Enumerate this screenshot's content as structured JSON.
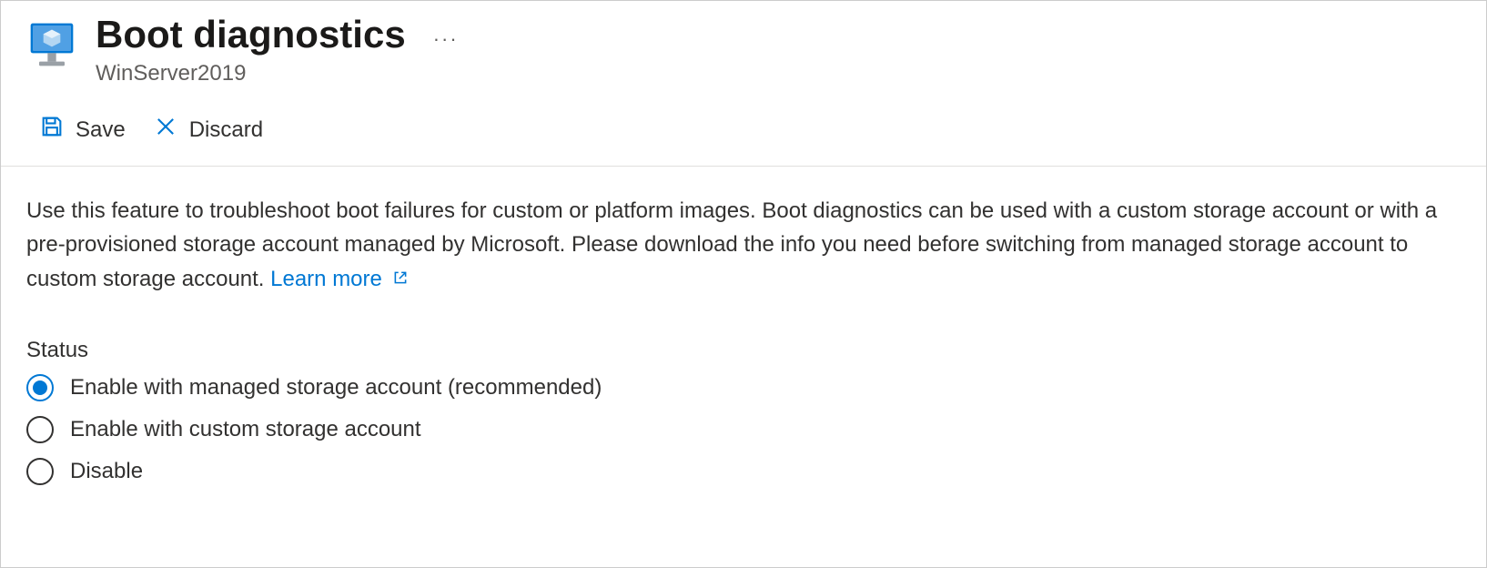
{
  "header": {
    "title": "Boot diagnostics",
    "subtitle": "WinServer2019"
  },
  "toolbar": {
    "save_label": "Save",
    "discard_label": "Discard"
  },
  "description": {
    "text": "Use this feature to troubleshoot boot failures for custom or platform images. Boot diagnostics can be used with a custom storage account or with a pre-provisioned storage account managed by Microsoft. Please download the info you need before switching from managed storage account to custom storage account.",
    "learn_more": "Learn more"
  },
  "status": {
    "label": "Status",
    "options": [
      {
        "label": "Enable with managed storage account (recommended)",
        "selected": true
      },
      {
        "label": "Enable with custom storage account",
        "selected": false
      },
      {
        "label": "Disable",
        "selected": false
      }
    ]
  }
}
